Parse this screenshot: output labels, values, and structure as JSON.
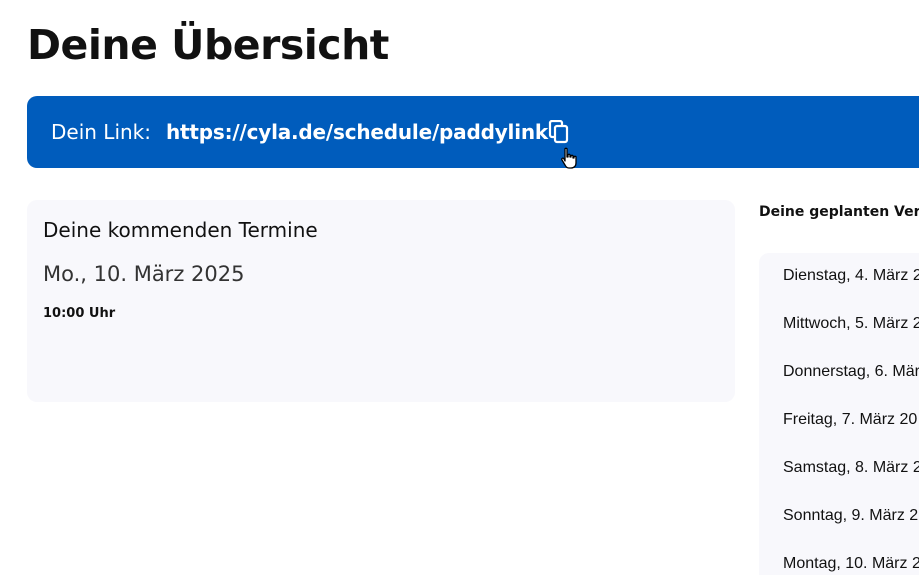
{
  "header": {
    "title": "Deine Übersicht"
  },
  "link_banner": {
    "label": "Dein Link:",
    "url": "https://cyla.de/schedule/paddylink",
    "copy_icon": "copy-icon",
    "background": "#005cbc"
  },
  "appointments": {
    "title": "Deine kommenden Termine",
    "items": [
      {
        "date": "Mo., 10. März 2025",
        "time": "10:00 Uhr"
      }
    ]
  },
  "availability": {
    "heading": "Deine geplanten Verf",
    "days": [
      "Dienstag, 4. März 2",
      "Mittwoch, 5. März 2",
      "Donnerstag, 6. Mär",
      "Freitag, 7. März 20",
      "Samstag, 8. März 2",
      "Sonntag, 9. März 2",
      "Montag, 10. März 2"
    ]
  }
}
